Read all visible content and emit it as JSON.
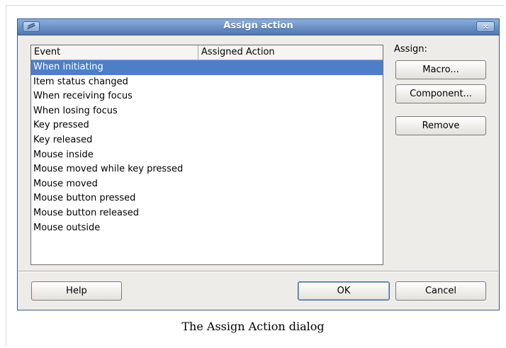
{
  "window": {
    "title": "Assign action",
    "close_glyph": "×",
    "app_icon": "edit-icon"
  },
  "event_list": {
    "columns": [
      "Event",
      "Assigned Action"
    ],
    "rows": [
      {
        "event": "When initiating",
        "action": "",
        "selected": true
      },
      {
        "event": "Item status changed",
        "action": ""
      },
      {
        "event": "When receiving focus",
        "action": ""
      },
      {
        "event": "When losing focus",
        "action": ""
      },
      {
        "event": "Key pressed",
        "action": ""
      },
      {
        "event": "Key released",
        "action": ""
      },
      {
        "event": "Mouse inside",
        "action": ""
      },
      {
        "event": "Mouse moved while key pressed",
        "action": ""
      },
      {
        "event": "Mouse moved",
        "action": ""
      },
      {
        "event": "Mouse button pressed",
        "action": ""
      },
      {
        "event": "Mouse button released",
        "action": ""
      },
      {
        "event": "Mouse outside",
        "action": ""
      }
    ]
  },
  "assign": {
    "label": "Assign:",
    "macro_label": "Macro...",
    "component_label": "Component...",
    "remove_label": "Remove"
  },
  "footer": {
    "help_label": "Help",
    "ok_label": "OK",
    "cancel_label": "Cancel"
  },
  "caption": "The Assign Action dialog",
  "colors": {
    "titlebar": "#6e95c8",
    "selection": "#4c7fc7",
    "dialog_bg": "#eeece8"
  }
}
